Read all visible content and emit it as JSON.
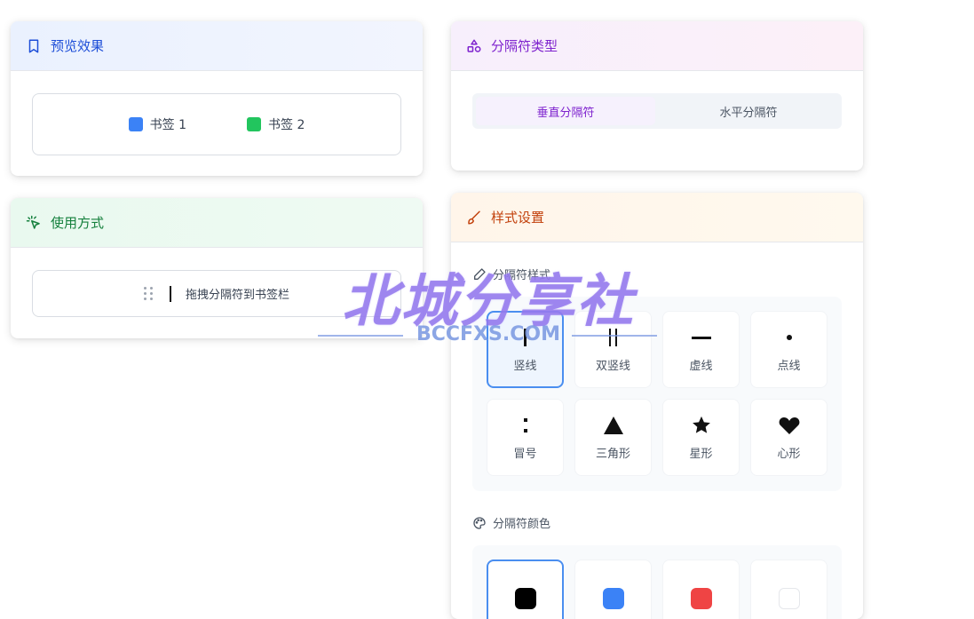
{
  "preview": {
    "title": "预览效果",
    "icon": "bookmark-icon",
    "bookmarks": [
      {
        "label": "书签 1",
        "color": "#3b82f6"
      },
      {
        "label": "书签 2",
        "color": "#22c55e"
      }
    ]
  },
  "usage": {
    "title": "使用方式",
    "icon": "cursor-click-icon",
    "hint": "拖拽分隔符到书签栏"
  },
  "separator_type": {
    "title": "分隔符类型",
    "icon": "shapes-icon",
    "options": [
      {
        "label": "垂直分隔符",
        "active": true
      },
      {
        "label": "水平分隔符",
        "active": false
      }
    ]
  },
  "style_settings": {
    "title": "样式设置",
    "icon": "brush-icon",
    "style_section": {
      "label": "分隔符样式",
      "icon": "pen-icon",
      "items": [
        {
          "label": "竖线",
          "symbol": "|",
          "selected": true
        },
        {
          "label": "双竖线",
          "symbol": "||",
          "selected": false
        },
        {
          "label": "虚线",
          "symbol": "—",
          "selected": false
        },
        {
          "label": "点线",
          "symbol": "•",
          "selected": false
        },
        {
          "label": "冒号",
          "symbol": ":",
          "selected": false
        },
        {
          "label": "三角形",
          "symbol": "▲",
          "selected": false
        },
        {
          "label": "星形",
          "symbol": "★",
          "selected": false
        },
        {
          "label": "心形",
          "symbol": "♥",
          "selected": false
        }
      ]
    },
    "color_section": {
      "label": "分隔符颜色",
      "icon": "palette-icon",
      "swatches": [
        {
          "color": "#000000",
          "selected": true
        },
        {
          "color": "#3b82f6",
          "selected": false
        },
        {
          "color": "#ef4444",
          "selected": false
        },
        {
          "color": "#ffffff",
          "selected": false
        }
      ]
    }
  },
  "watermark": {
    "title": "北城分享社",
    "subtitle": "BCCFXS.COM"
  }
}
